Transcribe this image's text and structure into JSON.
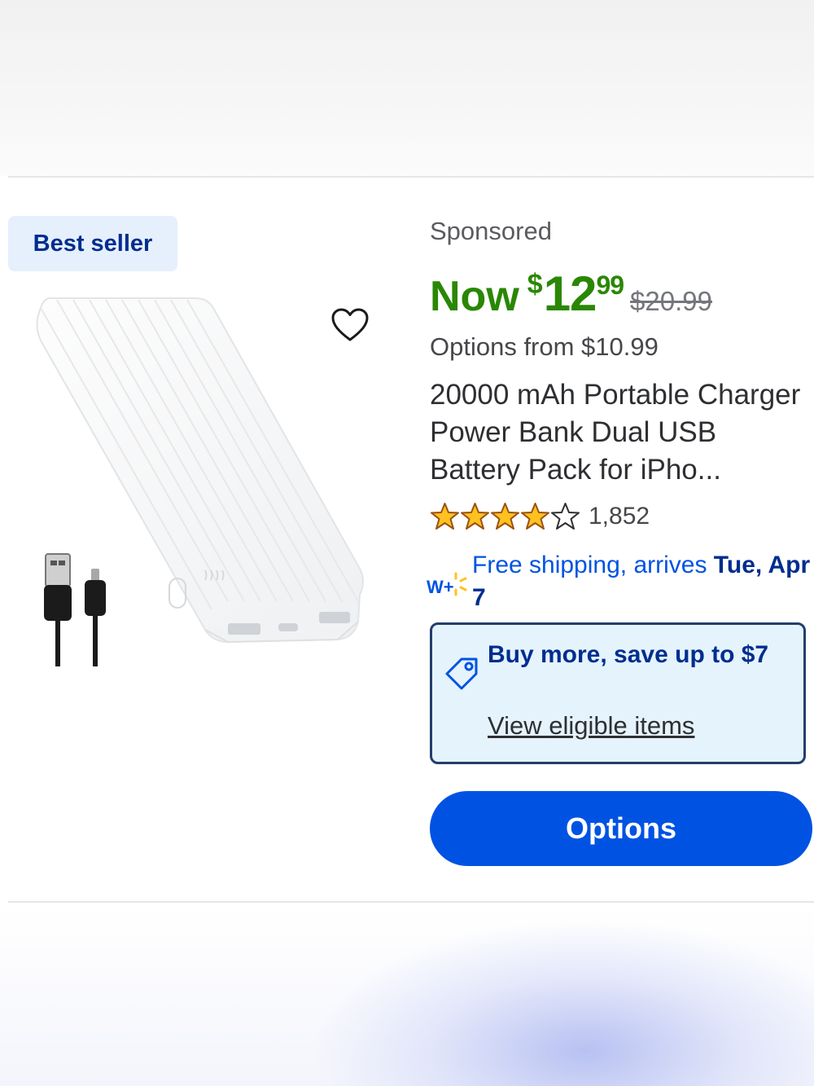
{
  "badge": {
    "label": "Best seller"
  },
  "product": {
    "sponsored_label": "Sponsored",
    "price_prefix": "Now",
    "price_currency": "$",
    "price_dollars": "12",
    "price_cents": "99",
    "was_price": "$20.99",
    "options_from": "Options from $10.99",
    "title": "20000 mAh Portable Charger Power Bank Dual USB Battery Pack for iPho...",
    "rating": 4,
    "rating_max": 5,
    "review_count": "1,852",
    "icons": {
      "favorite": "heart-icon",
      "walmart_plus": "walmart-plus-icon",
      "tag": "price-tag-icon"
    }
  },
  "shipping": {
    "text": "Free shipping, arrives ",
    "date": "Tue, Apr 7"
  },
  "promo": {
    "headline": "Buy more, save up to $7",
    "link": "View eligible items"
  },
  "actions": {
    "options_button": "Options"
  },
  "colors": {
    "price_green": "#2a8703",
    "primary_blue": "#0053e2",
    "dark_blue": "#002d8f",
    "star_yellow": "#ffc220"
  }
}
